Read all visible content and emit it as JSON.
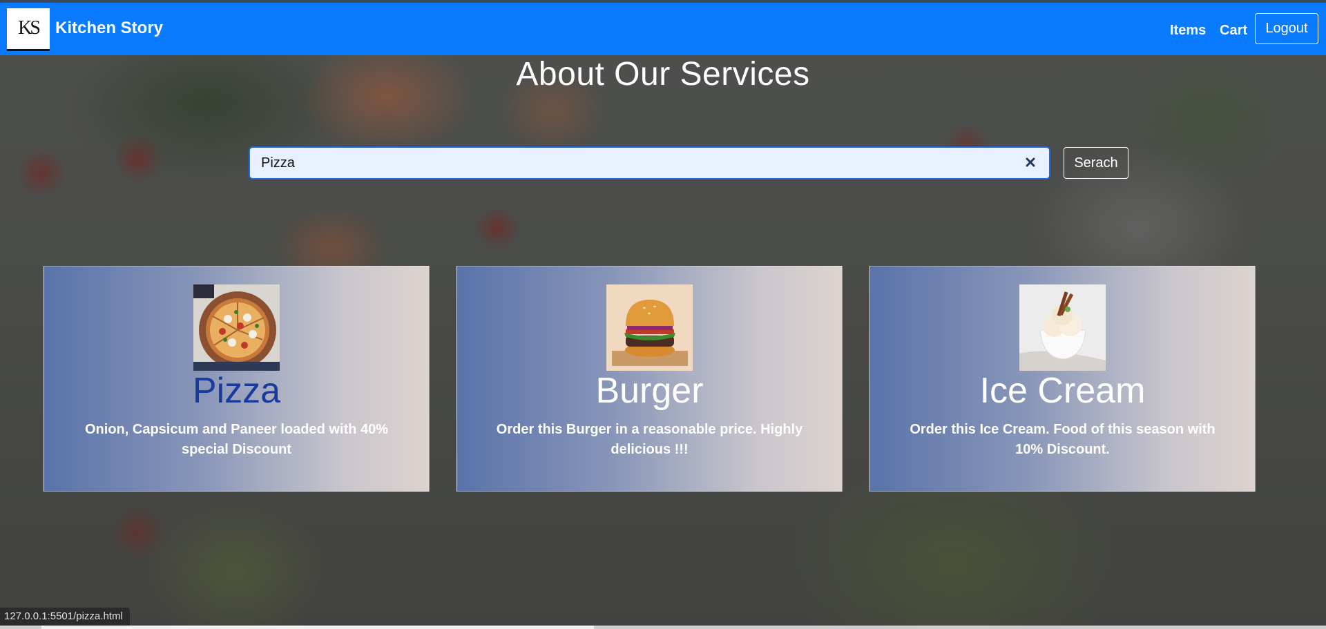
{
  "navbar": {
    "logo_text": "KS",
    "brand": "Kitchen Story",
    "links": [
      "Items",
      "Cart"
    ],
    "logout_label": "Logout",
    "color": "#0a7bff"
  },
  "page": {
    "title": "About Our Services"
  },
  "search": {
    "value": "Pizza",
    "button_label": "Serach"
  },
  "cards": [
    {
      "title": "Pizza",
      "description": "Onion, Capsicum and Paneer loaded with 40% special Discount",
      "image": "pizza-image"
    },
    {
      "title": "Burger",
      "description": "Order this Burger in a reasonable price. Highly delicious !!!",
      "image": "burger-image"
    },
    {
      "title": "Ice Cream",
      "description": "Order this Ice Cream. Food of this season with 10% Discount.",
      "image": "ice-cream-image"
    }
  ],
  "status_bar": {
    "url": "127.0.0.1:5501/pizza.html"
  }
}
